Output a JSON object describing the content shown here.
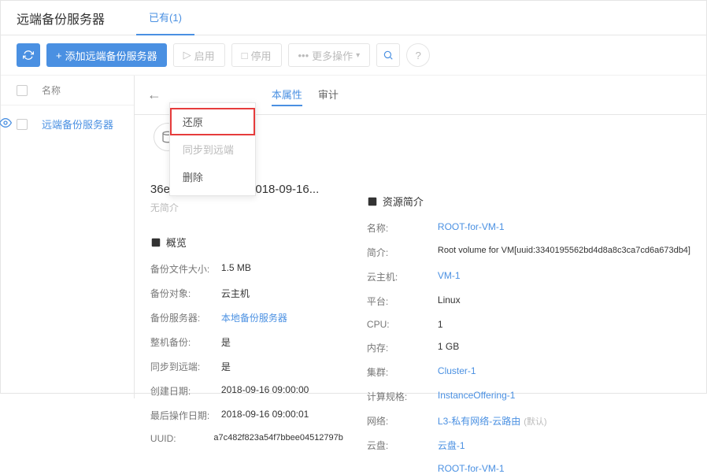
{
  "header": {
    "title": "远端备份服务器",
    "tab_label": "已有(1)"
  },
  "toolbar": {
    "add_label": "添加远端备份服务器",
    "start_label": "启用",
    "stop_label": "停用",
    "more_label": "更多操作"
  },
  "list": {
    "col_name": "名称",
    "rows": [
      {
        "name": "远端备份服务器"
      }
    ]
  },
  "detail": {
    "tabs": {
      "basic": "本属性",
      "audit": "审计"
    },
    "dropdown": {
      "restore": "还原",
      "sync": "同步到远端",
      "delete": "删除"
    },
    "title": "36eab640-backup-2018-09-16...",
    "subtitle": "无简介",
    "overview_title": "概览",
    "overview": {
      "size_label": "备份文件大小:",
      "size_value": "1.5 MB",
      "target_label": "备份对象:",
      "target_value": "云主机",
      "server_label": "备份服务器:",
      "server_value": "本地备份服务器",
      "whole_label": "整机备份:",
      "whole_value": "是",
      "sync_label": "同步到远端:",
      "sync_value": "是",
      "created_label": "创建日期:",
      "created_value": "2018-09-16 09:00:00",
      "lastop_label": "最后操作日期:",
      "lastop_value": "2018-09-16 09:00:01",
      "uuid_label": "UUID:",
      "uuid_value": "a7c482f823a54f7bbee04512797b"
    },
    "resource_title": "资源简介",
    "resource": {
      "name_label": "名称:",
      "name_value": "ROOT-for-VM-1",
      "brief_label": "简介:",
      "brief_value": "Root volume for VM[uuid:3340195562bd4d8a8c3ca7cd6a673db4]",
      "host_label": "云主机:",
      "host_value": "VM-1",
      "platform_label": "平台:",
      "platform_value": "Linux",
      "cpu_label": "CPU:",
      "cpu_value": "1",
      "mem_label": "内存:",
      "mem_value": "1 GB",
      "cluster_label": "集群:",
      "cluster_value": "Cluster-1",
      "plan_label": "计算规格:",
      "plan_value": "InstanceOffering-1",
      "net_label": "网络:",
      "net_value": "L3-私有网络-云路由",
      "net_badge": "(默认)",
      "disk_label": "云盘:",
      "disk_value": "云盘-1",
      "root_value": "ROOT-for-VM-1"
    }
  }
}
